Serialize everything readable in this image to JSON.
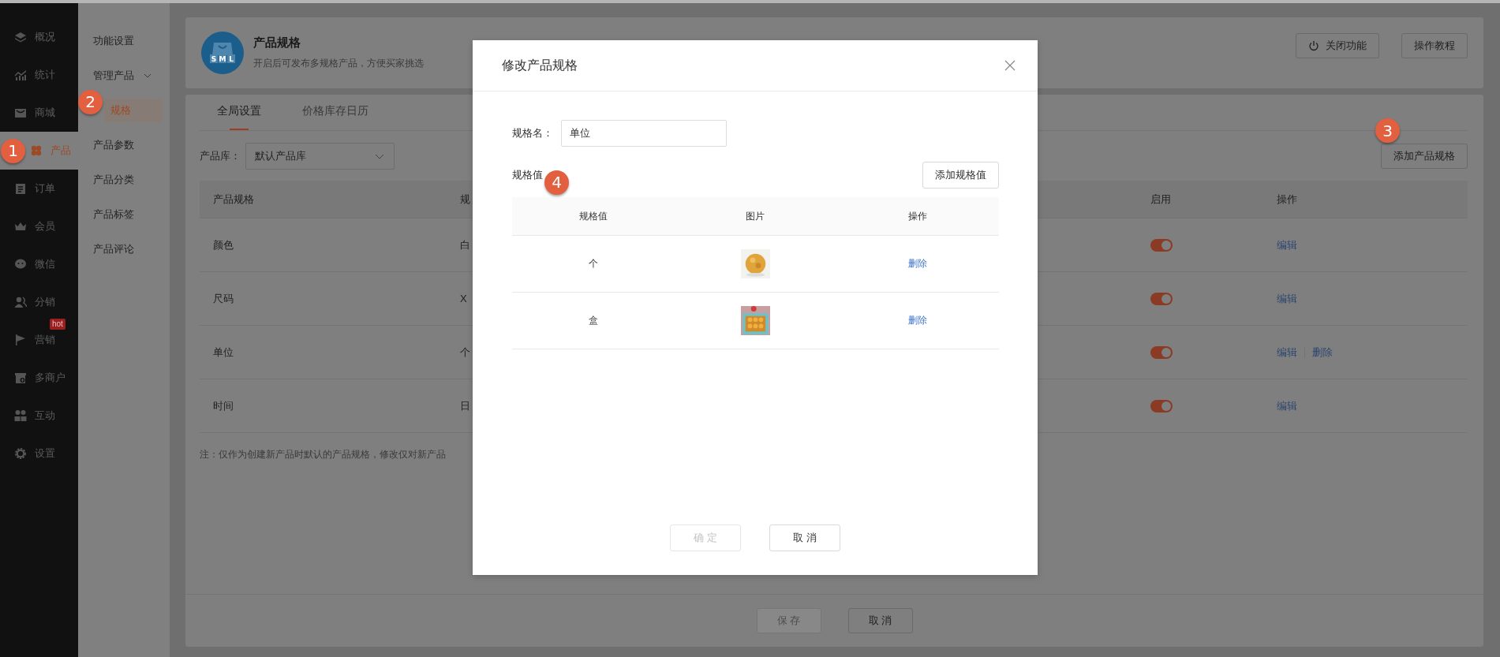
{
  "sidebar": {
    "items": [
      {
        "label": "概况",
        "selected": false
      },
      {
        "label": "统计",
        "selected": false
      },
      {
        "label": "商城",
        "selected": false
      },
      {
        "label": "产品",
        "selected": true,
        "callout": "1"
      },
      {
        "label": "订单",
        "selected": false
      },
      {
        "label": "会员",
        "selected": false
      },
      {
        "label": "微信",
        "selected": false
      },
      {
        "label": "分销",
        "selected": false
      },
      {
        "label": "营销",
        "selected": false,
        "badge": "hot"
      },
      {
        "label": "多商户",
        "selected": false
      },
      {
        "label": "互动",
        "selected": false
      },
      {
        "label": "设置",
        "selected": false
      }
    ]
  },
  "submenu": [
    {
      "label": "功能设置"
    },
    {
      "label": "管理产品",
      "expanded": true,
      "children": [
        {
          "label": "规格",
          "selected": true,
          "callout": "2"
        },
        {
          "label": "产品参数",
          "selected": false
        },
        {
          "label": "产品分类",
          "selected": false
        },
        {
          "label": "产品标签",
          "selected": false
        },
        {
          "label": "产品评论",
          "selected": false
        }
      ]
    }
  ],
  "header": {
    "logo_letters": [
      "S",
      "M",
      "L"
    ],
    "title": "产品规格",
    "subtitle": "开启后可发布多规格产品，方便买家挑选",
    "buttons": [
      {
        "label": "关闭功能",
        "kind": "power"
      },
      {
        "label": "操作教程",
        "kind": "plain"
      }
    ]
  },
  "tabs": [
    {
      "label": "全局设置",
      "selected": true
    },
    {
      "label": "价格库存日历",
      "selected": false
    }
  ],
  "library": {
    "label": "产品库：",
    "value": "默认产品库"
  },
  "add_button": {
    "label": "添加产品规格",
    "callout": "3"
  },
  "table": {
    "columns": [
      "产品规格",
      "规",
      "启用",
      "操作"
    ],
    "rows": [
      {
        "cells": [
          "颜色",
          "白"
        ],
        "enabled": true,
        "actions": [
          "编辑"
        ]
      },
      {
        "cells": [
          "尺码",
          "X"
        ],
        "enabled": true,
        "actions": [
          "编辑"
        ]
      },
      {
        "cells": [
          "单位",
          "个"
        ],
        "enabled": true,
        "actions": [
          "编辑",
          "删除"
        ]
      },
      {
        "cells": [
          "时间",
          "日"
        ],
        "enabled": true,
        "actions": [
          "编辑"
        ]
      }
    ]
  },
  "note": "注：仅作为创建新产品时默认的产品规格，修改仅对新产品",
  "footer": {
    "buttons": [
      {
        "label": "保 存",
        "disabled": true
      },
      {
        "label": "取 消",
        "disabled": false
      }
    ]
  },
  "modal": {
    "title": "修改产品规格",
    "name_label": "规格名：",
    "name_value": "单位",
    "values_label": "规格值",
    "callout": "4",
    "add_button": "添加规格值",
    "columns": [
      "规格值",
      "图片",
      "操作"
    ],
    "rows": [
      {
        "value": "个",
        "image": {
          "kind": "picture"
        },
        "actions": [
          "删除"
        ]
      },
      {
        "value": "盒",
        "image": {
          "kind": "picture"
        },
        "actions": [
          "删除"
        ]
      }
    ],
    "buttons": [
      {
        "label": "确 定",
        "disabled": true
      },
      {
        "label": "取 消",
        "disabled": false
      }
    ]
  }
}
